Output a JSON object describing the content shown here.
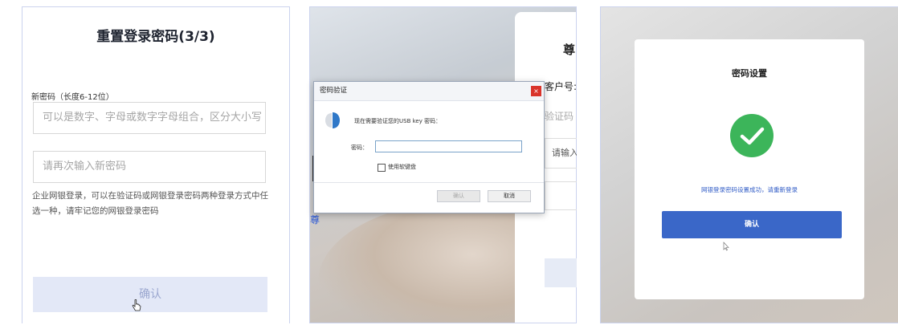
{
  "panel1": {
    "title": "重置登录密码(3/3)",
    "new_password_label": "新密码（长度6-12位）",
    "new_password_placeholder": "可以是数字、字母或数字字母组合，区分大小写",
    "confirm_password_placeholder": "请再次输入新密码",
    "note": "企业网银登录，可以在验证码或网银登录密码两种登录方式中任选一种，请牢记您的网银登录密码",
    "confirm_label": "确认"
  },
  "panel2": {
    "dialog": {
      "title": "密码验证",
      "close_label": "×",
      "message": "现在需要验证您的USB key 密码：",
      "password_label": "密码：",
      "soft_keyboard_label": "使用软键盘",
      "ok_label": "确认",
      "cancel_label": "取消"
    },
    "background_card": {
      "title_fragment": "尊",
      "customer_no_fragment": "客户号:",
      "verify_fragment": "验证码",
      "input_fragment": "请输入"
    },
    "background_text": {
      "large_char": "[",
      "small_char": "尊"
    }
  },
  "panel3": {
    "title": "密码设置",
    "success_message": "网银登录密码设置成功，请重新登录",
    "confirm_label": "确认",
    "success_color": "#3cb55a",
    "button_color": "#3a67c8"
  }
}
